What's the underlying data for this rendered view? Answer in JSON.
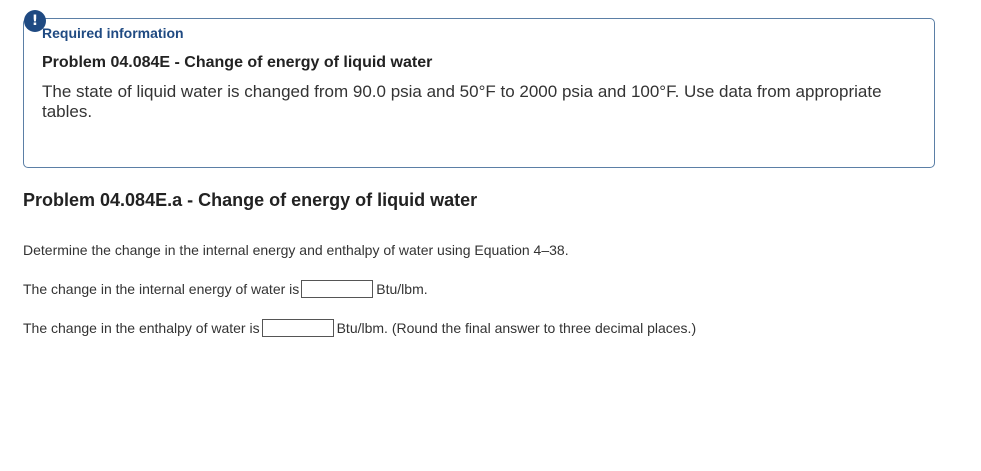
{
  "alert": {
    "icon": "exclamation-icon",
    "glyph": "!",
    "color": "#1f4a82"
  },
  "info": {
    "heading": "Required information",
    "subtitle": "Problem 04.084E - Change of energy of liquid water",
    "statement": "The state of liquid water is changed from 90.0 psia and 50°F to 2000 psia and 100°F. Use data from appropriate tables."
  },
  "part": {
    "title": "Problem 04.084E.a - Change of energy of liquid water",
    "instruction": "Determine the change in the internal energy and enthalpy of water using Equation 4–38.",
    "internal_energy": {
      "prefix": "The change in the internal energy of water is",
      "value": "",
      "suffix": "Btu/lbm."
    },
    "enthalpy": {
      "prefix": "The change in the enthalpy of water is",
      "value": "",
      "suffix": "Btu/lbm. (Round the final answer to three decimal places.)"
    }
  }
}
